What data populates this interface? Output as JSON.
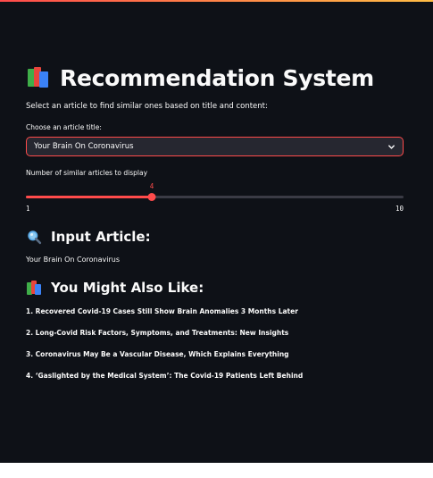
{
  "page": {
    "title": "Recommendation System",
    "intro": "Select an article to find similar ones based on title and content:"
  },
  "select": {
    "label": "Choose an article title:",
    "value": "Your Brain On Coronavirus"
  },
  "slider": {
    "label": "Number of similar articles to display",
    "min": 1,
    "max": 10,
    "value": 4,
    "min_label": "1",
    "max_label": "10",
    "value_label": "4"
  },
  "input_section": {
    "heading": "Input Article:",
    "article": "Your Brain On Coronavirus"
  },
  "recs_section": {
    "heading": "You Might Also Like:",
    "items": [
      "1. Recovered Covid-19 Cases Still Show Brain Anomalies 3 Months Later",
      "2. Long-Covid Risk Factors, Symptoms, and Treatments: New Insights",
      "3. Coronavirus May Be a Vascular Disease, Which Explains Everything",
      "4. ‘Gaslighted by the Medical System’: The Covid-19 Patients Left Behind"
    ]
  },
  "icons": {
    "title_icon": "books-icon",
    "input_icon": "magnifier-icon",
    "recs_icon": "books-icon",
    "select_chevron": "chevron-down-icon"
  },
  "colors": {
    "background": "#0e1117",
    "accent": "#ff4b4b",
    "text": "#fafafa",
    "select_bg": "#262730"
  }
}
